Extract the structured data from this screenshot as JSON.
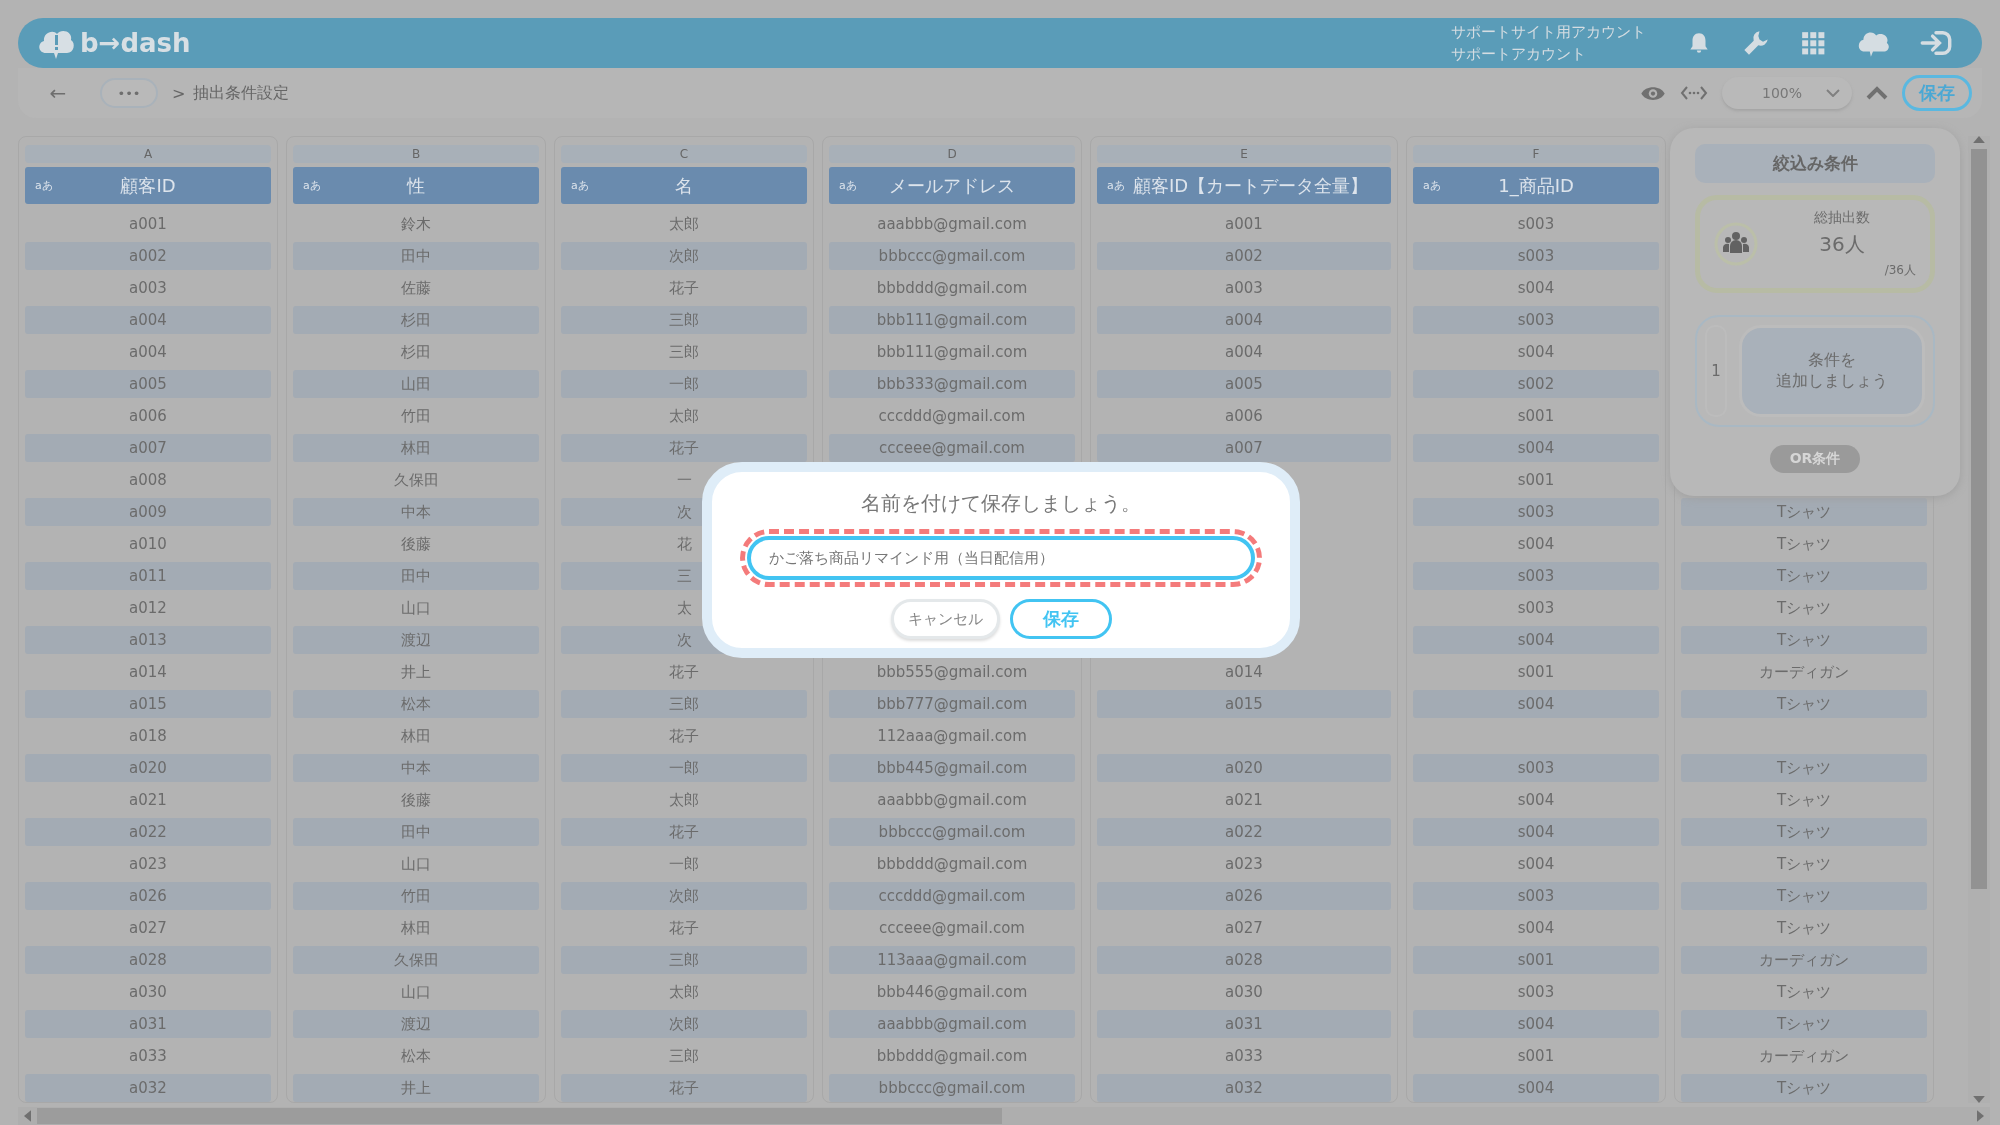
{
  "header": {
    "logo": "b→dash",
    "account_line_1": "サポートサイト用アカウント",
    "account_line_2": "サポートアカウント"
  },
  "toolbar": {
    "back": "←",
    "more": "•••",
    "separator": ">",
    "breadcrumb": "抽出条件設定",
    "zoom": "100%",
    "save": "保存"
  },
  "table": {
    "columns": [
      {
        "letter": "A",
        "type_label": "aあ",
        "label": "顧客ID"
      },
      {
        "letter": "B",
        "type_label": "aあ",
        "label": "性"
      },
      {
        "letter": "C",
        "type_label": "aあ",
        "label": "名"
      },
      {
        "letter": "D",
        "type_label": "aあ",
        "label": "メールアドレス"
      },
      {
        "letter": "E",
        "type_label": "aあ",
        "label": "顧客ID【カートデータ全量】"
      },
      {
        "letter": "F",
        "type_label": "aあ",
        "label": "1_商品ID"
      },
      {}
    ],
    "rows": [
      [
        "a001",
        "鈴木",
        "太郎",
        "aaabbb@gmail.com",
        "a001",
        "s003",
        null
      ],
      [
        "a002",
        "田中",
        "次郎",
        "bbbccc@gmail.com",
        "a002",
        "s003",
        null
      ],
      [
        "a003",
        "佐藤",
        "花子",
        "bbbddd@gmail.com",
        "a003",
        "s004",
        null
      ],
      [
        "a004",
        "杉田",
        "三郎",
        "bbb111@gmail.com",
        "a004",
        "s003",
        null
      ],
      [
        "a004",
        "杉田",
        "三郎",
        "bbb111@gmail.com",
        "a004",
        "s004",
        null
      ],
      [
        "a005",
        "山田",
        "一郎",
        "bbb333@gmail.com",
        "a005",
        "s002",
        null
      ],
      [
        "a006",
        "竹田",
        "太郎",
        "cccddd@gmail.com",
        "a006",
        "s001",
        null
      ],
      [
        "a007",
        "林田",
        "花子",
        "ccceee@gmail.com",
        "a007",
        "s004",
        null
      ],
      [
        "a008",
        "久保田",
        "一",
        null,
        null,
        "s001",
        null
      ],
      [
        "a009",
        "中本",
        "次",
        null,
        null,
        "s003",
        "Tシャツ"
      ],
      [
        "a010",
        "後藤",
        "花",
        null,
        null,
        "s004",
        "Tシャツ"
      ],
      [
        "a011",
        "田中",
        "三",
        null,
        null,
        "s003",
        "Tシャツ"
      ],
      [
        "a012",
        "山口",
        "太",
        null,
        null,
        "s003",
        "Tシャツ"
      ],
      [
        "a013",
        "渡辺",
        "次",
        null,
        null,
        "s004",
        "Tシャツ"
      ],
      [
        "a014",
        "井上",
        "花子",
        "bbb555@gmail.com",
        "a014",
        "s001",
        "カーディガン"
      ],
      [
        "a015",
        "松本",
        "三郎",
        "bbb777@gmail.com",
        "a015",
        "s004",
        "Tシャツ"
      ],
      [
        "a018",
        "林田",
        "花子",
        "112aaa@gmail.com",
        null,
        null,
        null
      ],
      [
        "a020",
        "中本",
        "一郎",
        "bbb445@gmail.com",
        "a020",
        "s003",
        "Tシャツ"
      ],
      [
        "a021",
        "後藤",
        "太郎",
        "aaabbb@gmail.com",
        "a021",
        "s004",
        "Tシャツ"
      ],
      [
        "a022",
        "田中",
        "花子",
        "bbbccc@gmail.com",
        "a022",
        "s004",
        "Tシャツ"
      ],
      [
        "a023",
        "山口",
        "一郎",
        "bbbddd@gmail.com",
        "a023",
        "s004",
        "Tシャツ"
      ],
      [
        "a026",
        "竹田",
        "次郎",
        "cccddd@gmail.com",
        "a026",
        "s003",
        "Tシャツ"
      ],
      [
        "a027",
        "林田",
        "花子",
        "ccceee@gmail.com",
        "a027",
        "s004",
        "Tシャツ"
      ],
      [
        "a028",
        "久保田",
        "三郎",
        "113aaa@gmail.com",
        "a028",
        "s001",
        "カーディガン"
      ],
      [
        "a030",
        "山口",
        "太郎",
        "bbb446@gmail.com",
        "a030",
        "s003",
        "Tシャツ"
      ],
      [
        "a031",
        "渡辺",
        "次郎",
        "aaabbb@gmail.com",
        "a031",
        "s004",
        "Tシャツ"
      ],
      [
        "a033",
        "松本",
        "三郎",
        "bbbddd@gmail.com",
        "a033",
        "s001",
        "カーディガン"
      ],
      [
        "a032",
        "井上",
        "花子",
        "bbbccc@gmail.com",
        "a032",
        "s004",
        "Tシャツ"
      ]
    ]
  },
  "filter_panel": {
    "title": "絞込み条件",
    "total_label": "総抽出数",
    "total": "36人",
    "total_of": "/36人",
    "condition_number": "1",
    "condition_hint": [
      "条件を",
      "追加しましょう"
    ],
    "or_button": {
      "label": "OR条件",
      "disabled": true
    }
  },
  "dialog": {
    "title": "名前を付けて保存しましょう。",
    "name_value": "かご落ち商品リマインド用（当日配信用）",
    "highlighted": true,
    "cancel": "キャンセル",
    "save": "保存"
  }
}
